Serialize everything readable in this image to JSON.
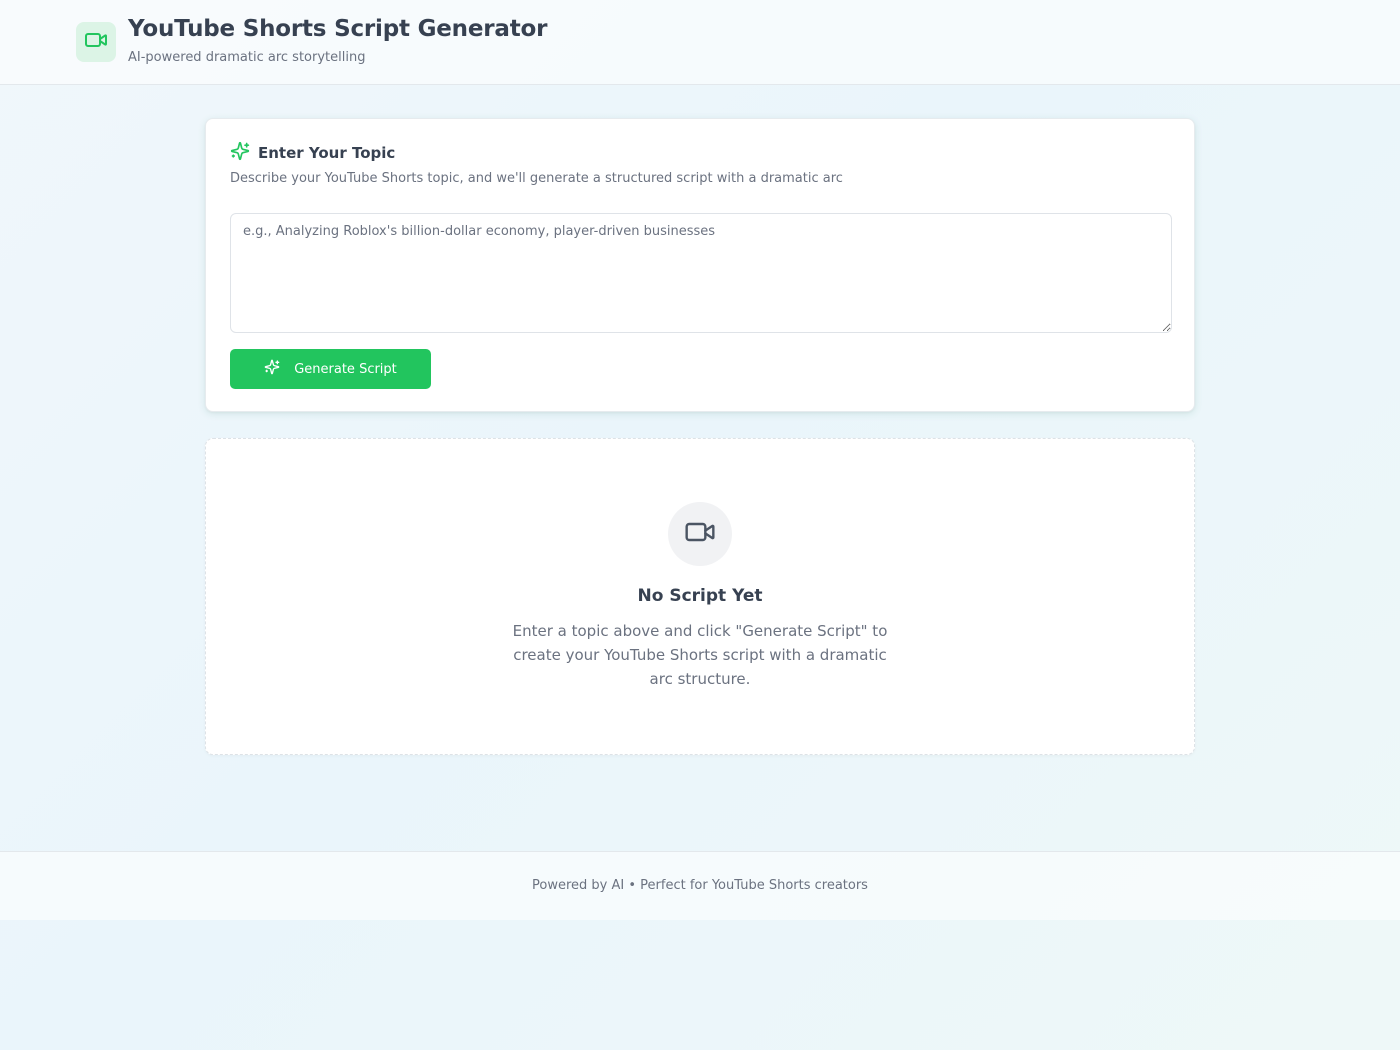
{
  "header": {
    "title": "YouTube Shorts Script Generator",
    "subtitle": "AI-powered dramatic arc storytelling",
    "logo_icon": "video-camera-icon"
  },
  "topic_card": {
    "icon": "sparkles-icon",
    "title": "Enter Your Topic",
    "description": "Describe your YouTube Shorts topic, and we'll generate a structured script with a dramatic arc",
    "input_value": "",
    "input_placeholder": "e.g., Analyzing Roblox's billion-dollar economy, player-driven businesses",
    "button_label": "Generate Script",
    "button_icon": "sparkles-icon"
  },
  "empty_state": {
    "icon": "video-camera-icon",
    "title": "No Script Yet",
    "description": "Enter a topic above and click \"Generate Script\" to create your YouTube Shorts script with a dramatic arc structure."
  },
  "footer": {
    "text": "Powered by AI • Perfect for YouTube Shorts creators"
  },
  "colors": {
    "accent": "#22c55e",
    "logo_background": "#dcf4e6",
    "text_primary": "#374151",
    "text_secondary": "#6b7280"
  }
}
